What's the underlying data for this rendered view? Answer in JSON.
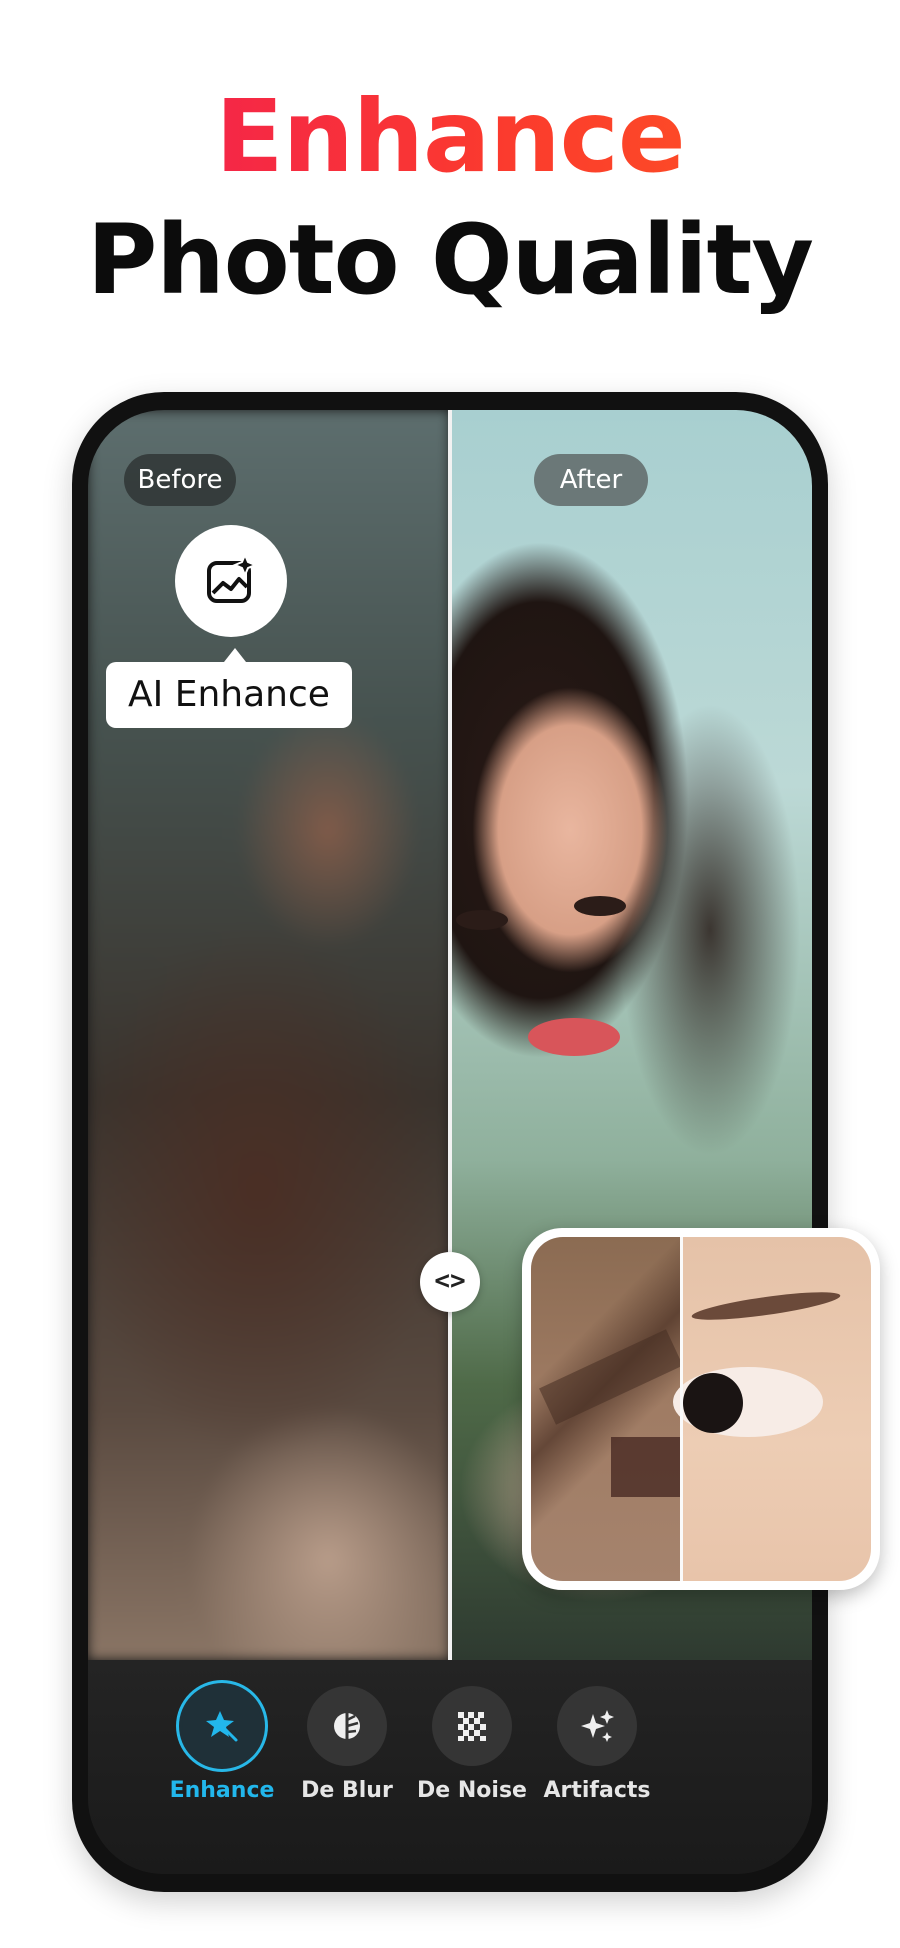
{
  "headline": {
    "line1": "Enhance",
    "line2": "Photo Quality"
  },
  "compare": {
    "before_label": "Before",
    "after_label": "After",
    "handle_glyph": "<>"
  },
  "feature_badge": {
    "icon": "ai-enhance-image-icon",
    "label": "AI Enhance"
  },
  "tabs": [
    {
      "label": "Enhance",
      "icon": "star-magic-icon",
      "active": true
    },
    {
      "label": "De Blur",
      "icon": "deblur-leaf-icon",
      "active": false
    },
    {
      "label": "De Noise",
      "icon": "denoise-pixel-icon",
      "active": false
    },
    {
      "label": "Artifacts",
      "icon": "sparkles-icon",
      "active": false
    }
  ],
  "colors": {
    "headline_gradient_start": "#f0185a",
    "headline_gradient_end": "#ff5a1f",
    "active_tab": "#22b7ec"
  }
}
